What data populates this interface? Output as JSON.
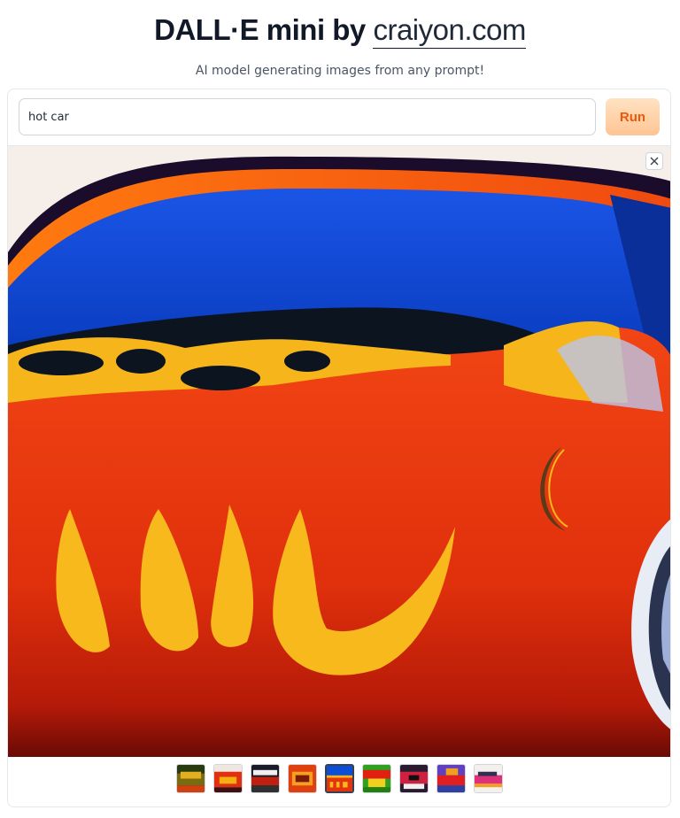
{
  "header": {
    "title": "DALL·E mini by",
    "brand": "craiyon.com",
    "subtitle": "AI model generating images from any prompt!"
  },
  "prompt": {
    "value": "hot car"
  },
  "actions": {
    "run_label": "Run"
  },
  "gallery": {
    "selected_index": 4,
    "thumbnails": [
      {
        "icon": "thumb-car-icon-1"
      },
      {
        "icon": "thumb-car-icon-2"
      },
      {
        "icon": "thumb-car-icon-3"
      },
      {
        "icon": "thumb-car-icon-4"
      },
      {
        "icon": "thumb-car-icon-5"
      },
      {
        "icon": "thumb-car-icon-6"
      },
      {
        "icon": "thumb-car-icon-7"
      },
      {
        "icon": "thumb-car-icon-8"
      },
      {
        "icon": "thumb-car-icon-9"
      }
    ]
  },
  "colors": {
    "accent": "#ea580c",
    "button_bg": "#ffc594",
    "car_red": "#e3340e",
    "flame_yellow": "#f8b91c",
    "sky_blue": "#0a4fd6"
  }
}
